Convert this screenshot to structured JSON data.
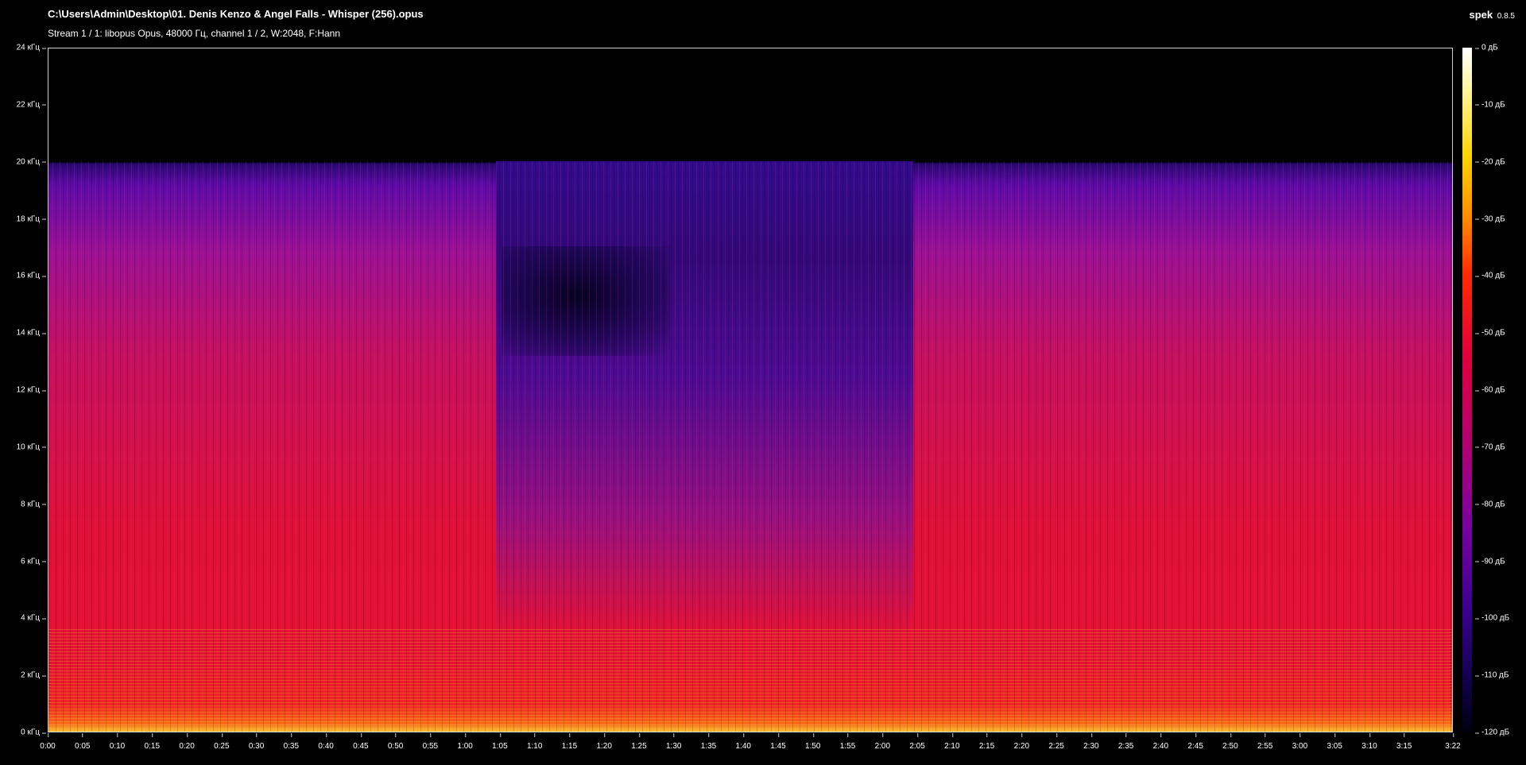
{
  "window": {
    "file_path": "C:\\Users\\Admin\\Desktop\\01. Denis Kenzo & Angel Falls - Whisper (256).opus",
    "stream_info": "Stream 1 / 1: libopus Opus, 48000 Гц, channel 1 / 2, W:2048, F:Hann",
    "app_name": "spek",
    "app_version": "0.8.5"
  },
  "axes": {
    "frequency_ticks": [
      "24 кГц",
      "22 кГц",
      "20 кГц",
      "18 кГц",
      "16 кГц",
      "14 кГц",
      "12 кГц",
      "10 кГц",
      "8 кГц",
      "6 кГц",
      "4 кГц",
      "2 кГц",
      "0 кГц"
    ],
    "time_ticks": [
      "0:00",
      "0:05",
      "0:10",
      "0:15",
      "0:20",
      "0:25",
      "0:30",
      "0:35",
      "0:40",
      "0:45",
      "0:50",
      "0:55",
      "1:00",
      "1:05",
      "1:10",
      "1:15",
      "1:20",
      "1:25",
      "1:30",
      "1:35",
      "1:40",
      "1:45",
      "1:50",
      "1:55",
      "2:00",
      "2:05",
      "2:10",
      "2:15",
      "2:20",
      "2:25",
      "2:30",
      "2:35",
      "2:40",
      "2:45",
      "2:50",
      "2:55",
      "3:00",
      "3:05",
      "3:10",
      "3:15",
      "3:22"
    ],
    "time_values_seconds": [
      0,
      5,
      10,
      15,
      20,
      25,
      30,
      35,
      40,
      45,
      50,
      55,
      60,
      65,
      70,
      75,
      80,
      85,
      90,
      95,
      100,
      105,
      110,
      115,
      120,
      125,
      130,
      135,
      140,
      145,
      150,
      155,
      160,
      165,
      170,
      175,
      180,
      185,
      190,
      195,
      202
    ],
    "duration_seconds": 202,
    "db_ticks": [
      "0 дБ",
      "-10 дБ",
      "-20 дБ",
      "-30 дБ",
      "-40 дБ",
      "-50 дБ",
      "-60 дБ",
      "-70 дБ",
      "-80 дБ",
      "-90 дБ",
      "-100 дБ",
      "-110 дБ",
      "-120 дБ"
    ]
  },
  "spectrogram": {
    "cutoff_khz": 20,
    "quiet_section": [
      "1:05",
      "2:05"
    ]
  }
}
